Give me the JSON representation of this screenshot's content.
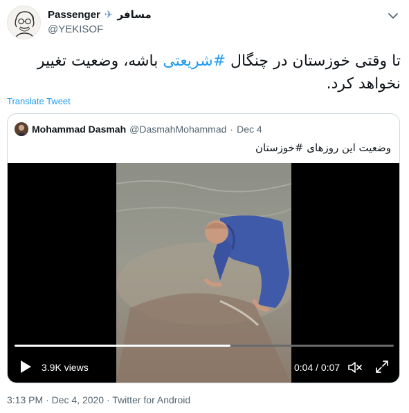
{
  "author": {
    "display_name": "Passenger",
    "display_name_fa": "مسافر",
    "handle": "@YEKISOF",
    "avatar_icon": "sketch-portrait-avatar",
    "badge_icon": "airplane-icon"
  },
  "tweet": {
    "text_before": "تا وقتی خوزستان در چنگال ",
    "hashtag": "#شریعتی",
    "text_after": " باشه، وضعیت تغییر نخواهد کرد.",
    "translate_label": "Translate Tweet"
  },
  "quote": {
    "name": "Mohammad Dasmah",
    "handle": "@DasmahMohammad",
    "separator": "·",
    "date": "Dec 4",
    "text": "وضعیت این روزهای #خوزستان"
  },
  "video": {
    "views": "3.9K views",
    "time": "0:04 / 0:07",
    "progress": 0.57
  },
  "footer": {
    "time": "3:13 PM",
    "date": "Dec 4, 2020",
    "source": "Twitter for Android",
    "dot": "·"
  },
  "colors": {
    "accent": "#1d9bf0",
    "muted": "#536471"
  }
}
